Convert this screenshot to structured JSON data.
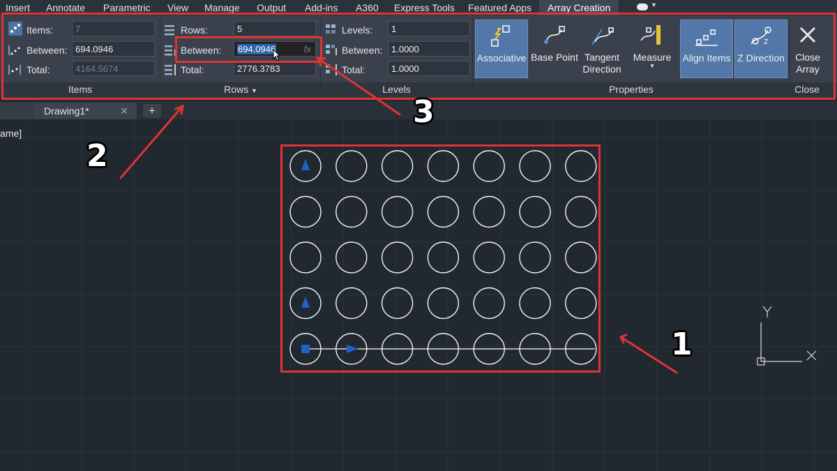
{
  "menu_tabs": [
    "Insert",
    "Annotate",
    "Parametric",
    "View",
    "Manage",
    "Output",
    "Add-ins",
    "A360",
    "Express Tools",
    "Featured Apps",
    "Array Creation"
  ],
  "ribbon": {
    "items_panel": {
      "title": "Items",
      "items_label": "Items:",
      "items_value": "7",
      "between_label": "Between:",
      "between_value": "694.0946",
      "total_label": "Total:",
      "total_value": "4164.5674"
    },
    "rows_panel": {
      "title": "Rows",
      "rows_label": "Rows:",
      "rows_value": "5",
      "between_label": "Between:",
      "between_value": "694.0946",
      "total_label": "Total:",
      "total_value": "2776.3783",
      "fx": "fx"
    },
    "levels_panel": {
      "title": "Levels",
      "levels_label": "Levels:",
      "levels_value": "1",
      "between_label": "Between:",
      "between_value": "1.0000",
      "total_label": "Total:",
      "total_value": "1.0000"
    },
    "properties_panel": {
      "title": "Properties",
      "associative": "Associative",
      "base_point": "Base Point",
      "tangent_line1": "Tangent",
      "tangent_line2": "Direction",
      "measure": "Measure",
      "align_items": "Align Items",
      "z_direction": "Z Direction"
    },
    "close_panel": {
      "title": "Close",
      "close_line1": "Close",
      "close_line2": "Array"
    }
  },
  "doc_tabs": {
    "drawing_tab": "Drawing1*",
    "add_tab": "+"
  },
  "viewport_label": "ame]",
  "ucs": {
    "x_label": "X",
    "y_label": "Y"
  },
  "array": {
    "rows": 5,
    "columns": 7
  },
  "callouts": {
    "one": "1",
    "two": "2",
    "three": "3"
  },
  "colors": {
    "annotation_red": "#e03434",
    "grip_blue": "#1f63c8",
    "active_button": "#5277a8"
  }
}
